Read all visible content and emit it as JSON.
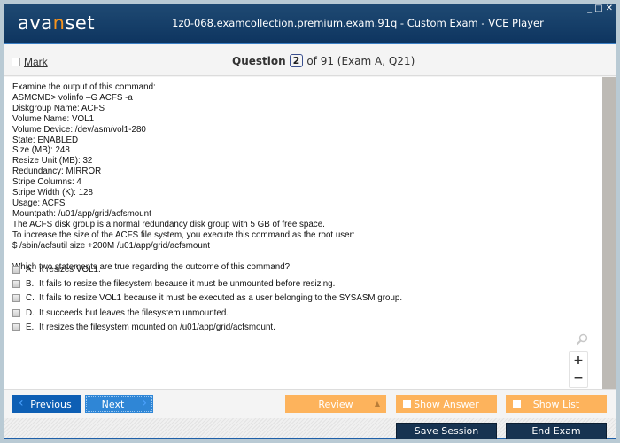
{
  "window": {
    "logo": {
      "prefix": "ava",
      "accent": "n",
      "suffix": "set"
    },
    "title": "1z0-068.examcollection.premium.exam.91q - Custom Exam - VCE Player",
    "controls": {
      "minimize": "_",
      "maximize": "□",
      "close": "✕"
    }
  },
  "question_bar": {
    "mark_label": "Mark",
    "question_label": "Question",
    "current": "2",
    "of_text": "of 91 (Exam A, Q21)"
  },
  "question": {
    "lines": [
      "Examine the output of this command:",
      "ASMCMD> volinfo –G ACFS -a",
      "Diskgroup Name: ACFS",
      "Volume Name: VOL1",
      "Volume Device: /dev/asm/vol1-280",
      "State: ENABLED",
      "Size (MB): 248",
      "Resize Unit (MB): 32",
      "Redundancy: MIRROR",
      "Stripe Columns: 4",
      "Stripe Width (K): 128",
      "Usage: ACFS",
      "Mountpath: /u01/app/grid/acfsmount",
      "The ACFS disk group is a normal redundancy disk group with 5 GB of free space.",
      "To increase the size of the ACFS file system, you execute this command as the root user:",
      "$ /sbin/acfsutil size +200M /u01/app/grid/acfsmount"
    ],
    "prompt": "Which two statements are true regarding the outcome of this command?",
    "options": [
      {
        "letter": "A.",
        "text": "It resizes VOL1."
      },
      {
        "letter": "B.",
        "text": "It fails to resize the filesystem because it must be unmounted before resizing."
      },
      {
        "letter": "C.",
        "text": "It fails to resize VOL1 because it must be executed as a user belonging to the SYSASM group."
      },
      {
        "letter": "D.",
        "text": "It succeeds but leaves the filesystem unmounted."
      },
      {
        "letter": "E.",
        "text": "It resizes the filesystem mounted on /u01/app/grid/acfsmount."
      }
    ]
  },
  "zoom_tools": {
    "zoom_in": "+",
    "zoom_out": "−",
    "magnifier": "⚲"
  },
  "footer": {
    "previous": "Previous",
    "next": "Next",
    "review": "Review",
    "show_answer": "Show Answer",
    "show_list": "Show List",
    "save_session": "Save Session",
    "end_exam": "End Exam"
  },
  "colors": {
    "header": "#0e3560",
    "accent_orange": "#fdb35c",
    "nav_blue": "#0e5fb4",
    "dark_button": "#173351"
  }
}
